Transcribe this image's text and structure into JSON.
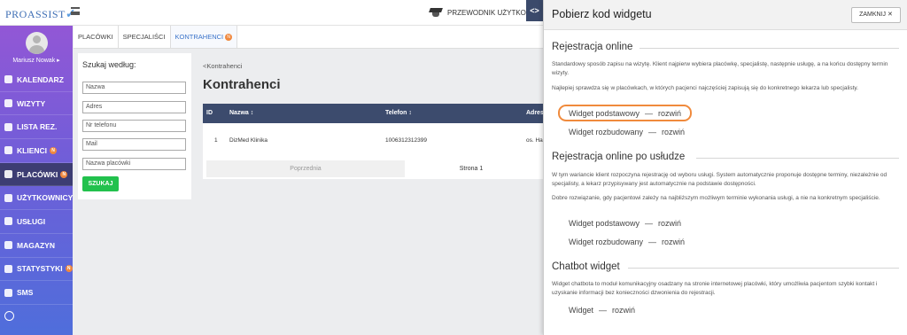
{
  "header": {
    "logo": "PROASSIST",
    "guide_label": "PRZEWODNIK UŻYTKOWNIKA",
    "toggle_symbol": "<>"
  },
  "sidebar": {
    "user_name": "Mariusz Nowak ▸",
    "items": [
      {
        "label": "KALENDARZ",
        "icon": "calendar-icon",
        "badge": ""
      },
      {
        "label": "WIZYTY",
        "icon": "visits-icon",
        "badge": ""
      },
      {
        "label": "LISTA REZ.",
        "icon": "list-icon",
        "badge": ""
      },
      {
        "label": "KLIENCI",
        "icon": "clients-icon",
        "badge": "N"
      },
      {
        "label": "PLACÓWKI",
        "icon": "branches-icon",
        "badge": "N"
      },
      {
        "label": "UŻYTKOWNICY",
        "icon": "users-icon",
        "badge": ""
      },
      {
        "label": "USŁUGI",
        "icon": "services-icon",
        "badge": ""
      },
      {
        "label": "MAGAZYN",
        "icon": "warehouse-icon",
        "badge": ""
      },
      {
        "label": "STATYSTYKI",
        "icon": "stats-icon",
        "badge": "N"
      },
      {
        "label": "SMS",
        "icon": "sms-icon",
        "badge": ""
      }
    ]
  },
  "tabs": [
    {
      "label": "PLACÓWKI"
    },
    {
      "label": "SPECJALIŚCI"
    },
    {
      "label": "KONTRAHENCI",
      "badge": "N"
    }
  ],
  "search": {
    "title": "Szukaj według:",
    "fields": [
      "Nazwa",
      "Adres",
      "Nr telefonu",
      "Mail",
      "Nazwa placówki"
    ],
    "button": "SZUKAJ"
  },
  "main": {
    "breadcrumb": "<Kontrahenci",
    "title": "Kontrahenci",
    "columns": [
      "ID",
      "Nazwa ↕",
      "Telefon ↕",
      "Adres"
    ],
    "rows": [
      {
        "id": "1",
        "name": "DizMed Klinika",
        "phone": "1006312312399",
        "address": "os. Ha"
      }
    ],
    "pager": {
      "prev": "Poprzednia",
      "page": "Strona 1"
    }
  },
  "panel": {
    "title": "Pobierz kod widgetu",
    "close": "ZAMKNIJ ✕",
    "sections": [
      {
        "title": "Rejestracja online",
        "desc": [
          "Standardowy sposób zapisu na wizytę. Klient najpierw wybiera placówkę, specjalistę, następnie usługę, a na końcu dostępny termin wizyty.",
          "Najlepiej sprawdza się w placówkach, w których pacjenci najczęściej zapisują się do konkretnego lekarza lub specjalisty."
        ],
        "links": [
          {
            "name": "Widget podstawowy",
            "action": "rozwiń"
          },
          {
            "name": "Widget rozbudowany",
            "action": "rozwiń"
          }
        ]
      },
      {
        "title": "Rejestracja online po usłudze",
        "desc": [
          "W tym wariancie klient rozpoczyna rejestrację od wyboru usługi. System automatycznie proponuje dostępne terminy, niezależnie od specjalisty, a lekarz przypisywany jest automatycznie na podstawie dostępności.",
          "Dobre rozwiązanie, gdy pacjentowi zależy na najbliższym możliwym terminie wykonania usługi, a nie na konkretnym specjaliście."
        ],
        "links": [
          {
            "name": "Widget podstawowy",
            "action": "rozwiń"
          },
          {
            "name": "Widget rozbudowany",
            "action": "rozwiń"
          }
        ]
      },
      {
        "title": "Chatbot widget",
        "desc": [
          "Widget chatbota to moduł komunikacyjny osadzany na stronie internetowej placówki, który umożliwia pacjentom szybki kontakt i uzyskanie informacji bez konieczności dzwonienia do rejestracji."
        ],
        "links": [
          {
            "name": "Widget",
            "action": "rozwiń"
          }
        ]
      }
    ],
    "dash": "—"
  },
  "colors": {
    "accent": "#3a73c9",
    "sidebar_top": "#9257d6",
    "sidebar_bottom": "#4f6edb",
    "table_header": "#3c4b6d",
    "search_button": "#22c14d",
    "highlight": "#f08a3c"
  }
}
